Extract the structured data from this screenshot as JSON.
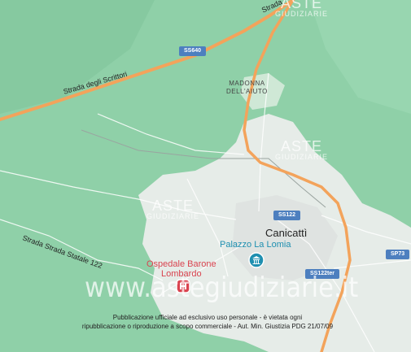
{
  "map": {
    "roads": {
      "road_scrittori": "Strada degli Scrittori",
      "road_statale_122": "Strada Strada Statale 122",
      "road_top": "Strada"
    },
    "shields": {
      "ss640": "SS640",
      "ss122": "SS122",
      "ss122ter": "SS122ter",
      "sp73": "SP73"
    },
    "places": {
      "madonna_line1": "MADONNA",
      "madonna_line2": "DELL'AIUTO",
      "city": "Canicattì"
    },
    "pois": {
      "palazzo": "Palazzo La Lomia",
      "ospedale_line1": "Ospedale Barone",
      "ospedale_line2": "Lombardo"
    },
    "watermarks": {
      "aste": "ASTE",
      "giudiziarie": "GIUDIZIARIE",
      "site": "www.astegiudiziarie.it"
    },
    "notice": {
      "line1": "Pubblicazione ufficiale ad esclusivo uso personale - è vietata ogni",
      "line2": "ripubblicazione o riproduzione a scopo commerciale - Aut. Min. Giustizia PDG 21/07/09"
    },
    "colors": {
      "terrain": "#8fd0a8",
      "urban": "#e8ece9",
      "motorway": "#f3a35b",
      "shield": "#4d7fbf",
      "poi_blue": "#1e8fb0",
      "poi_red": "#d9434f"
    }
  }
}
